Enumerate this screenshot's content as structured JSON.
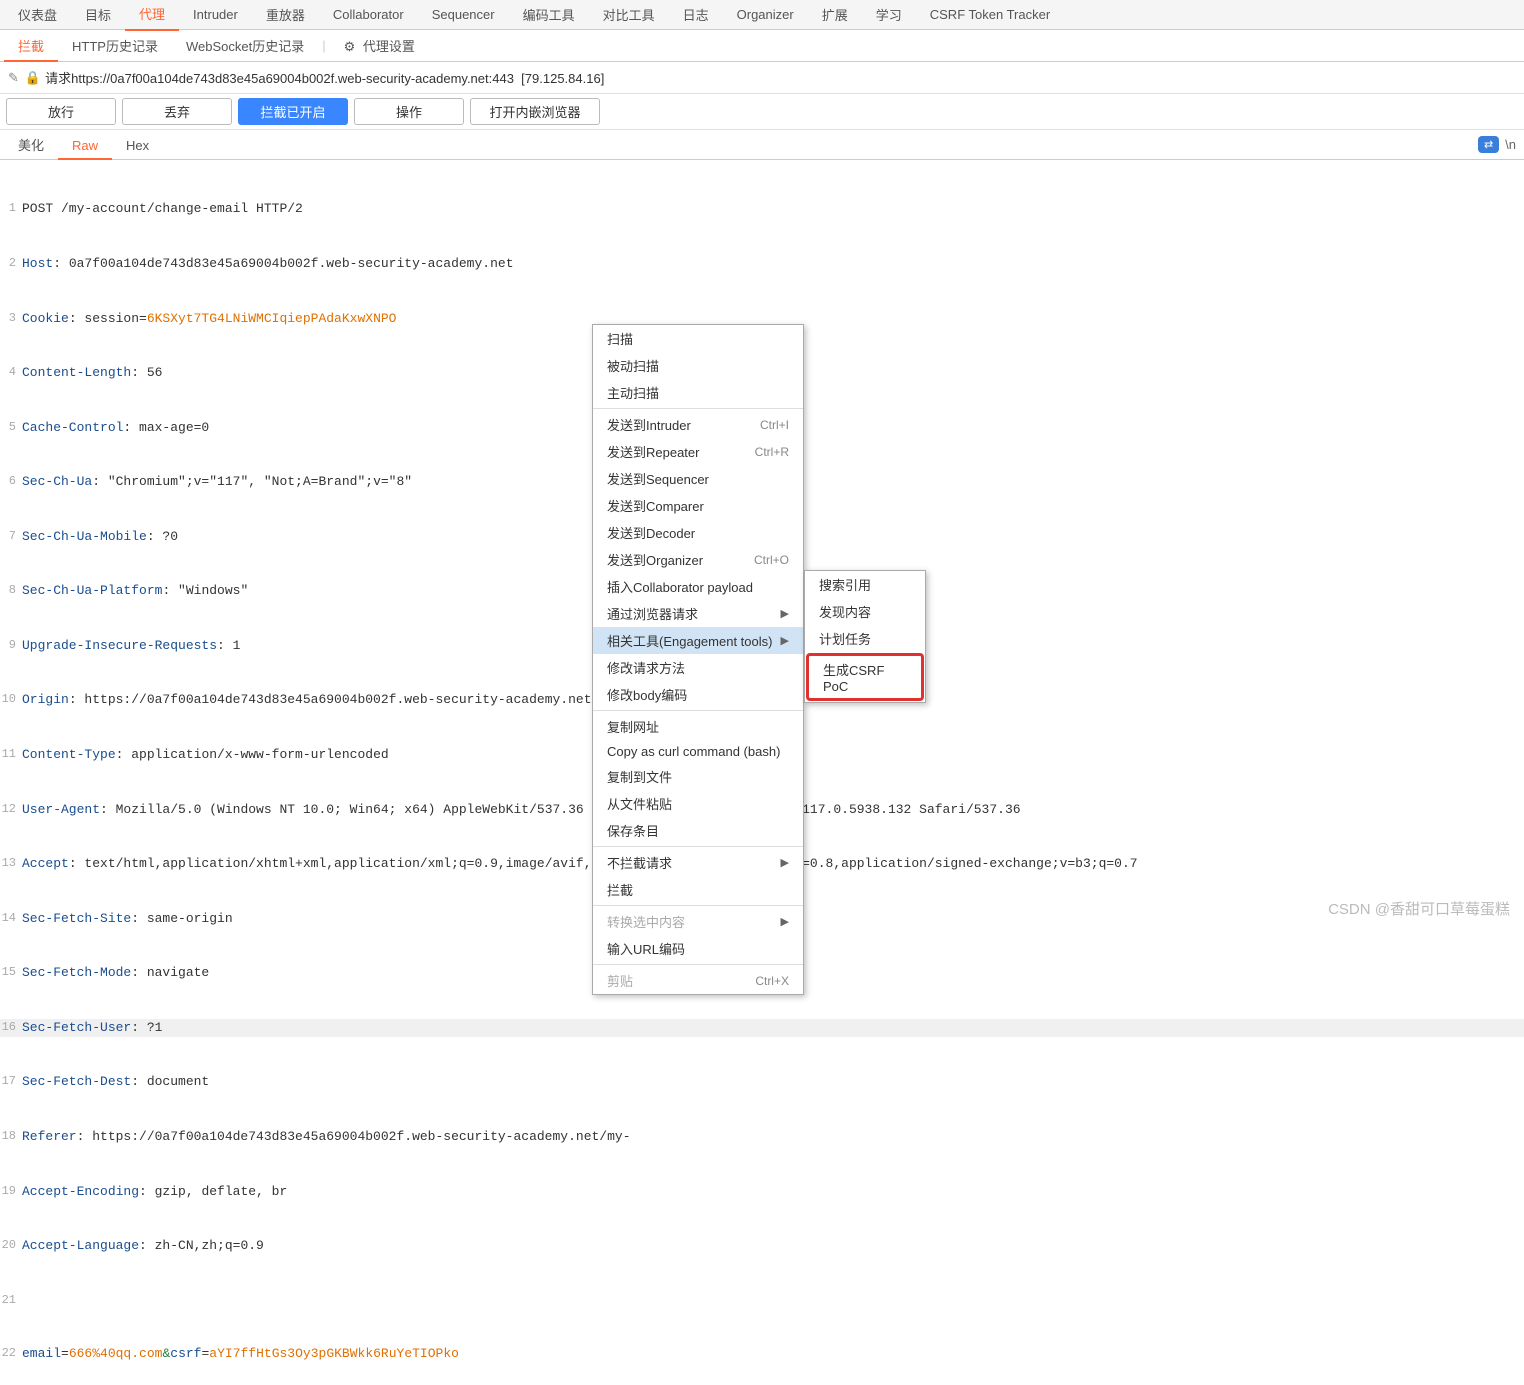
{
  "topTabs": [
    "仪表盘",
    "目标",
    "代理",
    "Intruder",
    "重放器",
    "Collaborator",
    "Sequencer",
    "编码工具",
    "对比工具",
    "日志",
    "Organizer",
    "扩展",
    "学习",
    "CSRF Token Tracker"
  ],
  "topActive": 2,
  "subTabs": {
    "items": [
      "拦截",
      "HTTP历史记录",
      "WebSocket历史记录"
    ],
    "active": 0,
    "proxySettings": "代理设置"
  },
  "request": {
    "prefix": "请求",
    "url": "https://0a7f00a104de743d83e45a69004b002f.web-security-academy.net:443",
    "ip": "[79.125.84.16]"
  },
  "actions": {
    "forward": "放行",
    "drop": "丢弃",
    "intercept": "拦截已开启",
    "action": "操作",
    "browser": "打开内嵌浏览器"
  },
  "viewTabs": [
    "美化",
    "Raw",
    "Hex"
  ],
  "viewActive": 1,
  "newline": "\\n",
  "http": {
    "l1": "POST /my-account/change-email HTTP/2",
    "l2h": "Host",
    "l2v": ": 0a7f00a104de743d83e45a69004b002f.web-security-academy.net",
    "l3h": "Cookie",
    "l3a": ": session=",
    "l3b": "6KSXyt7TG4LNiWMCIqiepPAdaKxwXNPO",
    "l4h": "Content-Length",
    "l4v": ": 56",
    "l5h": "Cache-Control",
    "l5v": ": max-age=0",
    "l6h": "Sec-Ch-Ua",
    "l6v": ": \"Chromium\";v=\"117\", \"Not;A=Brand\";v=\"8\"",
    "l7h": "Sec-Ch-Ua-Mobile",
    "l7v": ": ?0",
    "l8h": "Sec-Ch-Ua-Platform",
    "l8v": ": \"Windows\"",
    "l9h": "Upgrade-Insecure-Requests",
    "l9v": ": 1",
    "l10h": "Origin",
    "l10v": ": https://0a7f00a104de743d83e45a69004b002f.web-security-academy.net",
    "l11h": "Content-Type",
    "l11v": ": application/x-www-form-urlencoded",
    "l12h": "User-Agent",
    "l12v": ": Mozilla/5.0 (Windows NT 10.0; Win64; x64) AppleWebKit/537.36 (KHTML, like Gecko) Chrome/117.0.5938.132 Safari/537.36",
    "l13h": "Accept",
    "l13v": ": text/html,application/xhtml+xml,application/xml;q=0.9,image/avif,image/webp,image/apng,*/*;q=0.8,application/signed-exchange;v=b3;q=0.7",
    "l14h": "Sec-Fetch-Site",
    "l14v": ": same-origin",
    "l15h": "Sec-Fetch-Mode",
    "l15v": ": navigate",
    "l16h": "Sec-Fetch-User",
    "l16v": ": ?1",
    "l17h": "Sec-Fetch-Dest",
    "l17v": ": document",
    "l18h": "Referer",
    "l18v": ": https://0a7f00a104de743d83e45a69004b002f.web-security-academy.net/my-",
    "l19h": "Accept-Encoding",
    "l19v": ": gzip, deflate, br",
    "l20h": "Accept-Language",
    "l20v": ": zh-CN,zh;q=0.9",
    "bodyA": "email",
    "bodyB": "=",
    "bodyC": "666%40qq.com",
    "bodyD": "&",
    "bodyE": "csrf",
    "bodyF": "=",
    "bodyG": "aYI7ffHtGs3Oy3pGKBWkk6RuYeTIOPko"
  },
  "ctx": [
    {
      "t": "item",
      "label": "扫描"
    },
    {
      "t": "item",
      "label": "被动扫描"
    },
    {
      "t": "item",
      "label": "主动扫描"
    },
    {
      "t": "sep"
    },
    {
      "t": "item",
      "label": "发送到Intruder",
      "sc": "Ctrl+I"
    },
    {
      "t": "item",
      "label": "发送到Repeater",
      "sc": "Ctrl+R"
    },
    {
      "t": "item",
      "label": "发送到Sequencer"
    },
    {
      "t": "item",
      "label": "发送到Comparer"
    },
    {
      "t": "item",
      "label": "发送到Decoder"
    },
    {
      "t": "item",
      "label": "发送到Organizer",
      "sc": "Ctrl+O"
    },
    {
      "t": "item",
      "label": "插入Collaborator payload"
    },
    {
      "t": "item",
      "label": "通过浏览器请求",
      "arrow": true
    },
    {
      "t": "item",
      "label": "相关工具(Engagement tools)",
      "arrow": true,
      "selected": true
    },
    {
      "t": "item",
      "label": "修改请求方法"
    },
    {
      "t": "item",
      "label": "修改body编码"
    },
    {
      "t": "sep"
    },
    {
      "t": "item",
      "label": "复制网址"
    },
    {
      "t": "item",
      "label": "Copy as curl command (bash)"
    },
    {
      "t": "item",
      "label": "复制到文件"
    },
    {
      "t": "item",
      "label": "从文件粘贴"
    },
    {
      "t": "item",
      "label": "保存条目"
    },
    {
      "t": "sep"
    },
    {
      "t": "item",
      "label": "不拦截请求",
      "arrow": true
    },
    {
      "t": "item",
      "label": "拦截"
    },
    {
      "t": "sep"
    },
    {
      "t": "item",
      "label": "转换选中内容",
      "arrow": true,
      "disabled": true
    },
    {
      "t": "item",
      "label": "输入URL编码"
    },
    {
      "t": "sep"
    },
    {
      "t": "item",
      "label": "剪贴",
      "sc": "Ctrl+X",
      "disabled": true
    }
  ],
  "submenu": [
    "搜索引用",
    "发现内容",
    "计划任务",
    "生成CSRF PoC"
  ],
  "watermark": "CSDN @香甜可口草莓蛋糕"
}
